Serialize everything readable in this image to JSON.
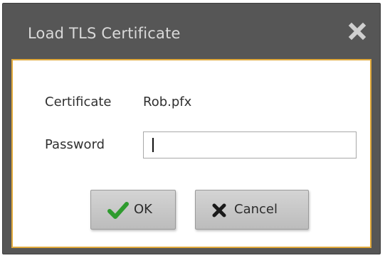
{
  "dialog": {
    "title": "Load TLS Certificate",
    "close_icon": "close-icon"
  },
  "form": {
    "certificate_label": "Certificate",
    "certificate_value": "Rob.pfx",
    "password_label": "Password",
    "password_value": ""
  },
  "buttons": {
    "ok_label": "OK",
    "ok_icon": "checkmark-icon",
    "cancel_label": "Cancel",
    "cancel_icon": "x-icon"
  },
  "colors": {
    "titlebar": "#565656",
    "content_border": "#e0a83a",
    "ok_check": "#2e9b2e"
  }
}
